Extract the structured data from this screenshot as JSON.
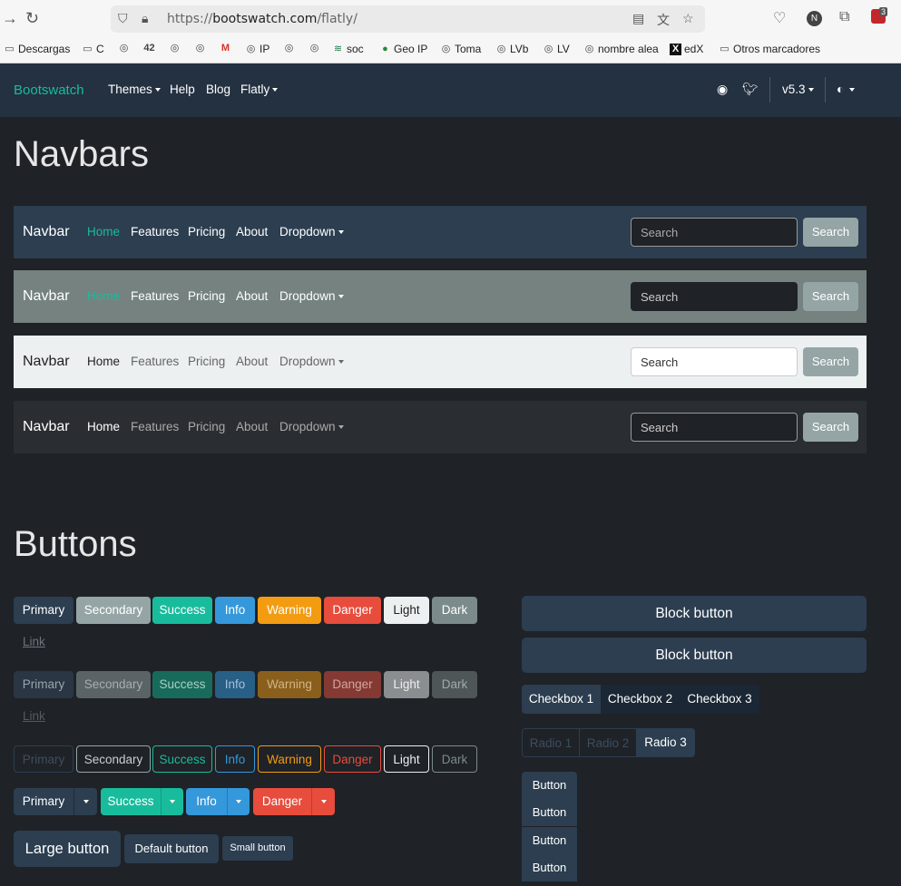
{
  "browser": {
    "url_prefix": "https://",
    "url_host": "bootswatch.com",
    "url_path": "/flatly/",
    "profile_initial": "N",
    "extension_badge": "3",
    "bookmarks": [
      "Descargas",
      "C",
      "IP",
      "soc",
      "Geo IP",
      "Toma",
      "LVb",
      "LV",
      "nombre alea",
      "edX",
      "Otros marcadores"
    ]
  },
  "site_nav": {
    "brand": "Bootswatch",
    "themes": "Themes",
    "help": "Help",
    "blog": "Blog",
    "flatly": "Flatly",
    "version": "v5.3"
  },
  "navbars_section": {
    "title": "Navbars",
    "brand": "Navbar",
    "links": [
      "Home",
      "Features",
      "Pricing",
      "About",
      "Dropdown"
    ],
    "search_placeholder": "Search",
    "search_button": "Search"
  },
  "buttons_section": {
    "title": "Buttons",
    "solid": [
      "Primary",
      "Secondary",
      "Success",
      "Info",
      "Warning",
      "Danger",
      "Light",
      "Dark"
    ],
    "link": "Link",
    "split": [
      "Primary",
      "Success",
      "Info",
      "Danger"
    ],
    "sizes": [
      "Large button",
      "Default button",
      "Small button"
    ],
    "block": [
      "Block button",
      "Block button"
    ],
    "checkboxes": [
      "Checkbox 1",
      "Checkbox 2",
      "Checkbox 3"
    ],
    "radios": [
      "Radio 1",
      "Radio 2",
      "Radio 3"
    ],
    "vertical": [
      "Button",
      "Button",
      "Button",
      "Button"
    ]
  },
  "colors": {
    "primary": "#2c3e50",
    "secondary": "#95a5a6",
    "success": "#18bc9c",
    "info": "#3498db",
    "warning": "#f39c12",
    "danger": "#e74c3c",
    "light": "#ecf0f1",
    "dark": "#7b8a8b",
    "page_bg": "#1f2227"
  }
}
